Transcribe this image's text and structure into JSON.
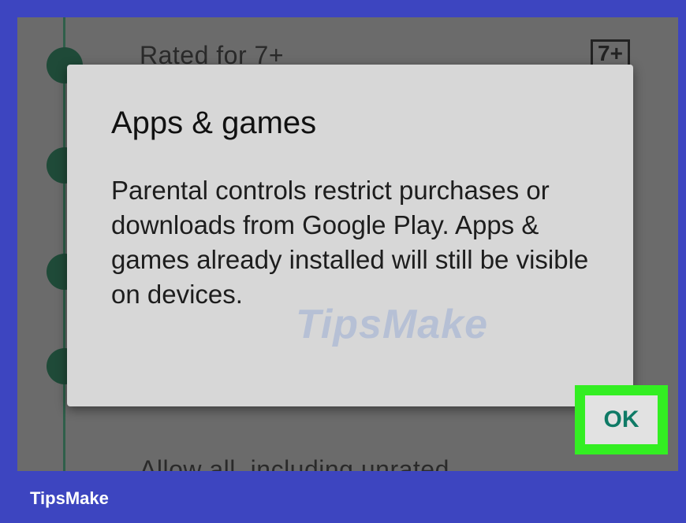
{
  "background_list": {
    "top_item": "Rated for 7+",
    "rating_badge": "7+",
    "bottom_item": "Allow all, including unrated"
  },
  "dialog": {
    "title": "Apps & games",
    "message": "Parental controls restrict purchases or downloads from Google Play. Apps & games already installed will still be visible on devices.",
    "ok_label": "OK"
  },
  "watermark": "TipsMake",
  "footer": {
    "brand": "TipsMake"
  },
  "colors": {
    "frame": "#3d45c0",
    "highlight": "#33ee22",
    "ok_text": "#0f7a66"
  }
}
